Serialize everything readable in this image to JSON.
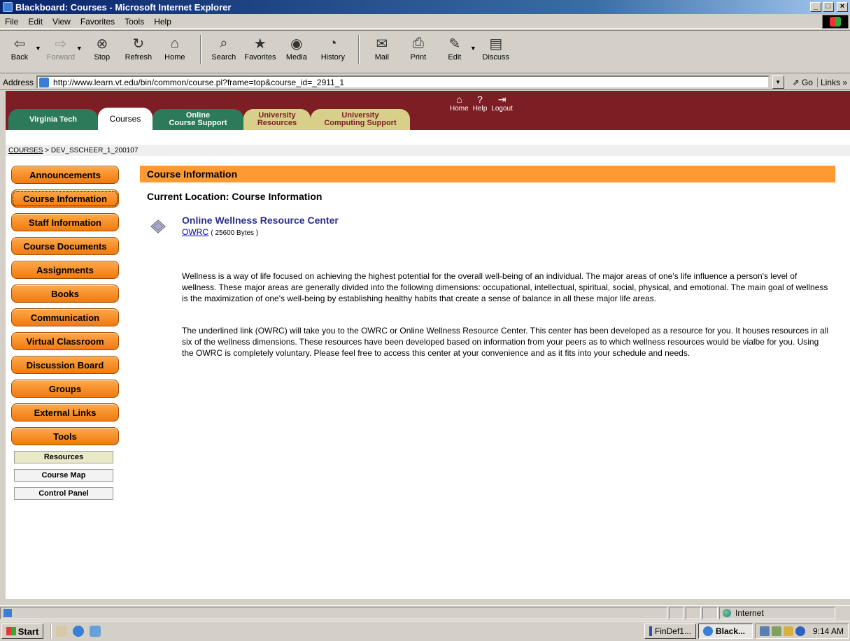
{
  "window": {
    "title": "Blackboard: Courses - Microsoft Internet Explorer"
  },
  "menu": [
    "File",
    "Edit",
    "View",
    "Favorites",
    "Tools",
    "Help"
  ],
  "toolbar": {
    "back": "Back",
    "forward": "Forward",
    "stop": "Stop",
    "refresh": "Refresh",
    "home": "Home",
    "search": "Search",
    "favorites": "Favorites",
    "media": "Media",
    "history": "History",
    "mail": "Mail",
    "print": "Print",
    "edit": "Edit",
    "discuss": "Discuss"
  },
  "address": {
    "label": "Address",
    "url": "http://www.learn.vt.edu/bin/common/course.pl?frame=top&course_id=_2911_1",
    "go": "Go",
    "links": "Links"
  },
  "header": {
    "tabs": {
      "vt": "Virginia Tech",
      "courses": "Courses",
      "ocs_line1": "Online",
      "ocs_line2": "Course Support",
      "ur_line1": "University",
      "ur_line2": "Resources",
      "ucs_line1": "University",
      "ucs_line2": "Computing Support"
    },
    "icons": {
      "home": "Home",
      "help": "Help",
      "logout": "Logout"
    }
  },
  "breadcrumb": {
    "root": "COURSES",
    "sep": ">",
    "current": "DEV_SSCHEER_1_200107"
  },
  "nav": {
    "buttons": [
      "Announcements",
      "Course Information",
      "Staff Information",
      "Course Documents",
      "Assignments",
      "Books",
      "Communication",
      "Virtual Classroom",
      "Discussion Board",
      "Groups",
      "External Links",
      "Tools"
    ],
    "active": "Course Information",
    "sub": [
      "Resources",
      "Course Map",
      "Control Panel"
    ]
  },
  "main": {
    "heading": "Course Information",
    "current_location": "Current Location: Course Information",
    "item": {
      "title": "Online Wellness Resource Center",
      "link": "OWRC",
      "size": "( 25600 Bytes )"
    },
    "paragraphs": [
      "Wellness is a way of life focused on achieving the highest potential for the overall well-being of an individual. The major areas of one's life influence a person's level of wellness. These major areas are generally divided into the following dimensions: occupational, intellectual, spiritual, social, physical, and emotional. The main goal of wellness is the maximization of one's well-being by establishing healthy habits that create a sense of balance in all these major life areas.",
      "The underlined link (OWRC) will take you to the OWRC or Online Wellness Resource Center. This center has been developed as a resource for you. It houses resources in all six of the wellness dimensions. These resources have been developed based on information from your peers as to which wellness resources would be vialbe for you. Using the OWRC is completely voluntary. Please feel free to access this center at your convenience and as it fits into your schedule and needs."
    ]
  },
  "status": {
    "zone": "Internet"
  },
  "taskbar": {
    "start": "Start",
    "tasks": [
      "FinDef1...",
      "Black..."
    ],
    "clock": "9:14 AM"
  }
}
